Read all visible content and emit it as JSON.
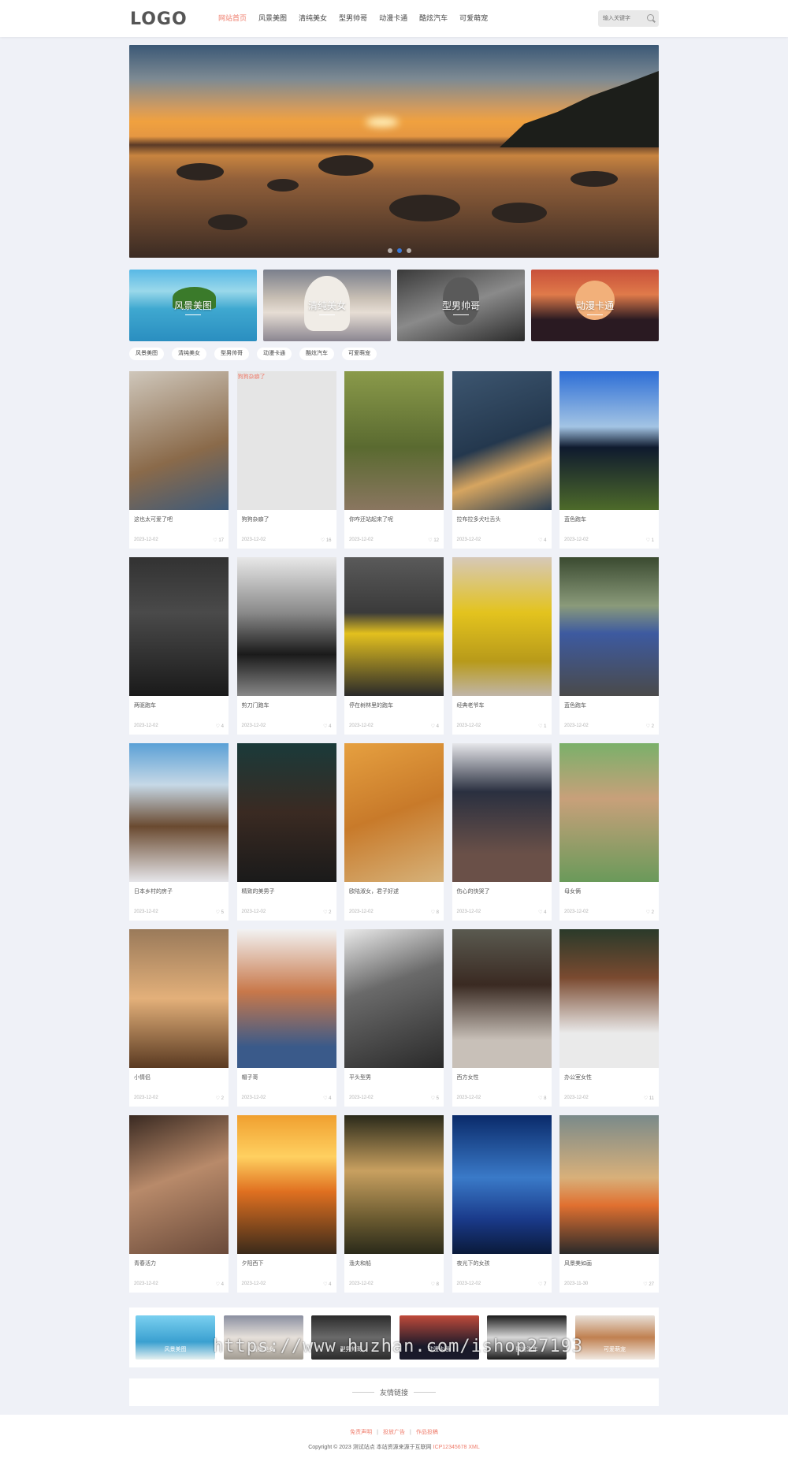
{
  "header": {
    "logo": "LOGO",
    "nav": [
      "网站首页",
      "风景美图",
      "清纯美女",
      "型男帅哥",
      "动漫卡通",
      "酷炫汽车",
      "可爱萌宠"
    ],
    "active_index": 0,
    "search_placeholder": "输入关键字"
  },
  "banner": {
    "slides": 3,
    "active_slide": 1
  },
  "categories": [
    {
      "label": "风景美图"
    },
    {
      "label": "清纯美女"
    },
    {
      "label": "型男帅哥"
    },
    {
      "label": "动漫卡通"
    }
  ],
  "tags": [
    "风景美图",
    "清纯美女",
    "型男帅哥",
    "动漫卡通",
    "酷炫汽车",
    "可爱萌宠"
  ],
  "posts": [
    {
      "title": "这也太可爱了吧",
      "date": "2023-12-02",
      "likes": "17",
      "bg": "linear-gradient(160deg,#cfc7bb,#8a6a4a 60%,#3d5a7a)",
      "icon": "puppy-image"
    },
    {
      "title": "狗狗杂癖了",
      "date": "2023-12-02",
      "likes": "16",
      "bg": "",
      "missing_alt": "狗狗杂癖了",
      "icon": "broken-image"
    },
    {
      "title": "你咋还站起来了呢",
      "date": "2023-12-02",
      "likes": "12",
      "bg": "linear-gradient(180deg,#8a9a4a,#5a6a30 55%,#8a7660)",
      "icon": "corgi-image"
    },
    {
      "title": "拉布拉多犬吐舌头",
      "date": "2023-12-02",
      "likes": "4",
      "bg": "linear-gradient(160deg,#3d5670,#24384e 50%,#d6a560 70%,#2b3e52)",
      "icon": "labrador-image"
    },
    {
      "title": "蓝色跑车",
      "date": "2023-12-02",
      "likes": "1",
      "bg": "linear-gradient(180deg,#2d6ed6,#a3c4e4 40%,#0f1a2e 55%,#4d6a2a)",
      "icon": "blue-car-image"
    },
    {
      "title": "两驱跑车",
      "date": "2023-12-02",
      "likes": "4",
      "bg": "linear-gradient(180deg,#323232,#4a4a4a 40%,#1a1a1a)",
      "icon": "sports-car-image"
    },
    {
      "title": "剪刀门跑车",
      "date": "2023-12-02",
      "likes": "4",
      "bg": "linear-gradient(180deg,#e8e8e8,#8a8a8a 40%,#1a1a1a 70%,#888)",
      "icon": "scissor-door-car-image"
    },
    {
      "title": "停在树林里的跑车",
      "date": "2023-12-02",
      "likes": "4",
      "bg": "linear-gradient(180deg,#5a5a5a,#3a3a3a 40%,#e3c01e 55%,#2a2a2a)",
      "icon": "yellow-car-image"
    },
    {
      "title": "经典老爷车",
      "date": "2023-12-02",
      "likes": "1",
      "bg": "linear-gradient(180deg,#d6c8b8,#e3c31e 40%,#b89a1a 75%,#c0b5a8)",
      "icon": "classic-car-image"
    },
    {
      "title": "蓝色跑车",
      "date": "2023-12-02",
      "likes": "2",
      "bg": "linear-gradient(180deg,#3a4a30,#8a9a7a 35%,#3d5aa0 55%,#4a4a4a)",
      "icon": "mustang-image"
    },
    {
      "title": "日本乡村的房子",
      "date": "2023-12-02",
      "likes": "5",
      "bg": "linear-gradient(180deg,#5aa0d6,#c6d8e6 30%,#6a4a30 60%,#e6e6ea)",
      "icon": "anime-house-image"
    },
    {
      "title": "精致的美男子",
      "date": "2023-12-02",
      "likes": "2",
      "bg": "linear-gradient(180deg,#1a3a3a,#3a2a22 50%,#1a1a1a)",
      "icon": "anime-man-image"
    },
    {
      "title": "欧陆淑女，君子好逑",
      "date": "2023-12-02",
      "likes": "8",
      "bg": "linear-gradient(160deg,#e6a040,#c87a2a 50%,#d6b27a)",
      "icon": "anime-woman-image"
    },
    {
      "title": "伤心的快哭了",
      "date": "2023-12-02",
      "likes": "4",
      "bg": "linear-gradient(180deg,#e6e6ea,#2a3040 35%,#6a5048 80%)",
      "icon": "sad-girl-image"
    },
    {
      "title": "母女俩",
      "date": "2023-12-02",
      "likes": "2",
      "bg": "linear-gradient(180deg,#7ab06a,#c8a07a 40%,#6a9a5a)",
      "icon": "mother-daughter-image"
    },
    {
      "title": "小情侣",
      "date": "2023-12-02",
      "likes": "2",
      "bg": "linear-gradient(180deg,#9a7a5a,#e3b07a 50%,#5a3a22)",
      "icon": "couple-image"
    },
    {
      "title": "帽子哥",
      "date": "2023-12-02",
      "likes": "4",
      "bg": "linear-gradient(180deg,#f2f2f2,#c8784a 45%,#3a5a8a 85%)",
      "icon": "cap-man-image"
    },
    {
      "title": "平头型男",
      "date": "2023-12-02",
      "likes": "5",
      "bg": "linear-gradient(160deg,#eaeaea,#6a6a6a 40%,#2a2a2a)",
      "icon": "man-portrait-image"
    },
    {
      "title": "西方女性",
      "date": "2023-12-02",
      "likes": "8",
      "bg": "linear-gradient(180deg,#5a5a50,#3a2a22 40%,#c8c0b8 80%)",
      "icon": "woman-scarf-image"
    },
    {
      "title": "办公室女性",
      "date": "2023-12-02",
      "likes": "11",
      "bg": "linear-gradient(180deg,#2a3a2a,#7a4a30 35%,#eaeaea 75%)",
      "icon": "office-woman-image"
    },
    {
      "title": "青春活力",
      "date": "2023-12-02",
      "likes": "4",
      "bg": "linear-gradient(160deg,#3a2a22,#b88a6a 45%,#6a4a3a)",
      "icon": "youth-image"
    },
    {
      "title": "夕阳西下",
      "date": "2023-12-02",
      "likes": "4",
      "bg": "linear-gradient(180deg,#f0a030,#ffd060 30%,#e07020 55%,#3a2a1a)",
      "icon": "sunset-image"
    },
    {
      "title": "渔夫和船",
      "date": "2023-12-02",
      "likes": "8",
      "bg": "linear-gradient(180deg,#2a2a1a,#c8a060 40%,#6a5a30 75%,#2a2a1a)",
      "icon": "fisherman-image"
    },
    {
      "title": "夜光下的女孩",
      "date": "2023-12-02",
      "likes": "7",
      "bg": "linear-gradient(180deg,#0a2a6a,#3a7ac8 45%,#1a3a8a 75%,#0a1a3a)",
      "icon": "night-girl-image"
    },
    {
      "title": "风景美如画",
      "date": "2023-11-30",
      "likes": "27",
      "bg": "linear-gradient(180deg,#7a8a8a,#d8b07a 45%,#e07030 65%,#2a2a2a)",
      "icon": "landscape-image"
    }
  ],
  "strip": [
    {
      "label": "风景美图",
      "bg": "linear-gradient(180deg,#7ad0f0,#3aa0d0 60%,#e6f0f0)"
    },
    {
      "label": "清纯美女",
      "bg": "linear-gradient(180deg,#8a8fa0,#e6e0da 50%,#a09a90)"
    },
    {
      "label": "型男帅哥",
      "bg": "linear-gradient(180deg,#2a2a2a,#6a6a6a 50%,#2a2a2a)"
    },
    {
      "label": "动漫卡通",
      "bg": "linear-gradient(180deg,#c04a3a,#1a1a2a 70%)"
    },
    {
      "label": "酷炫汽车",
      "bg": "linear-gradient(180deg,#1a1a1a,#d8d8d8 50%,#1a1a1a)"
    },
    {
      "label": "可爱萌宠",
      "bg": "linear-gradient(180deg,#e8e0d8,#c08050 50%,#f0e8e0)"
    }
  ],
  "watermark": "https://www.huzhan.com/ishop27193",
  "friend_links": {
    "title": "友情链接"
  },
  "footer": {
    "links": [
      "免责声明",
      "投放广告",
      "作品投稿"
    ],
    "copyright": "Copyright © 2023 测试站点 本站资源来源于互联网",
    "icp": "ICP12345678 XML"
  }
}
